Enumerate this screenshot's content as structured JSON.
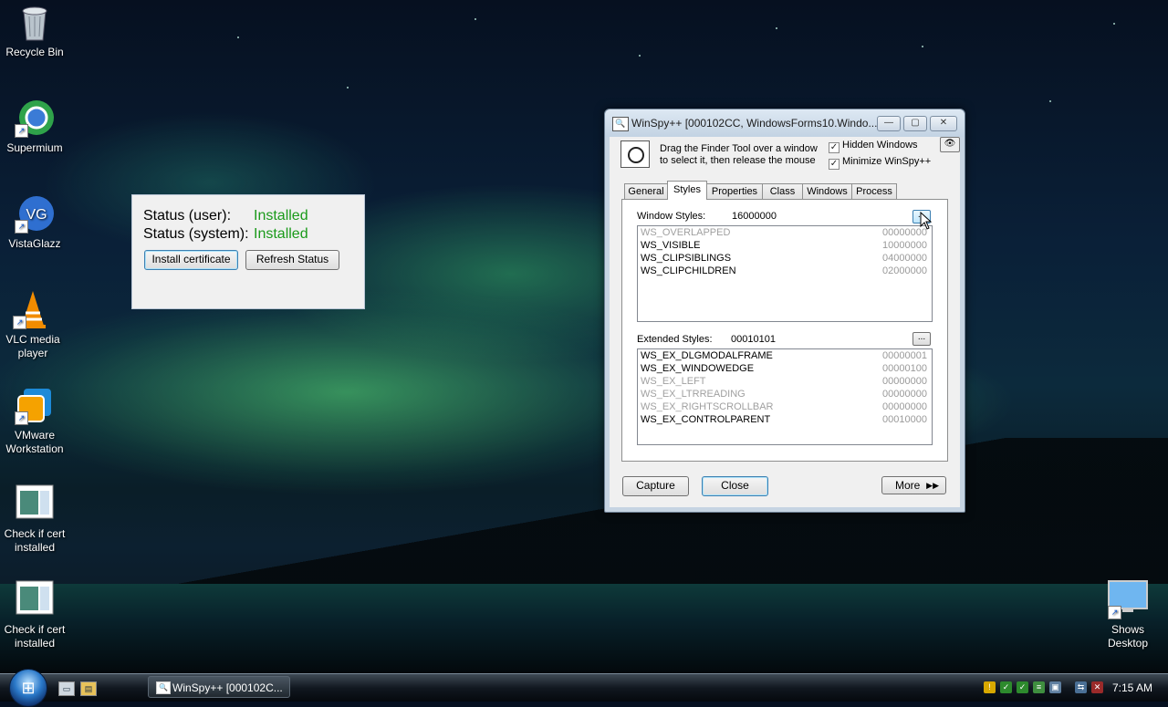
{
  "desktop": {
    "icons": [
      {
        "label": "Recycle Bin",
        "icon": "recycle-bin-icon"
      },
      {
        "label": "Supermium",
        "icon": "supermium-icon"
      },
      {
        "label": "VistaGlazz",
        "icon": "vistaglazz-icon"
      },
      {
        "label": "VLC media player",
        "icon": "vlc-icon"
      },
      {
        "label": "VMware Workstation",
        "icon": "vmware-icon"
      },
      {
        "label": "Check if cert installed",
        "icon": "cert-app-icon"
      },
      {
        "label": "Check if cert installed",
        "icon": "cert-app-icon"
      },
      {
        "label": "Shows Desktop",
        "icon": "show-desktop-icon"
      }
    ]
  },
  "status_panel": {
    "user_label": "Status (user):",
    "user_value": "Installed",
    "system_label": "Status (system):",
    "system_value": "Installed",
    "install_button": "Install certificate",
    "refresh_button": "Refresh Status",
    "status_color": "#1a9a1a"
  },
  "winspy": {
    "title": "WinSpy++ [000102CC, WindowsForms10.Windo...",
    "finder_text": "Drag the Finder Tool over a window to select it, then release the mouse",
    "hidden_windows_label": "Hidden Windows",
    "hidden_windows_checked": true,
    "minimize_label": "Minimize WinSpy++",
    "minimize_checked": true,
    "tabs": [
      "General",
      "Styles",
      "Properties",
      "Class",
      "Windows",
      "Process"
    ],
    "active_tab": "Styles",
    "window_styles_label": "Window Styles:",
    "window_styles_value": "16000000",
    "window_styles": [
      {
        "name": "WS_OVERLAPPED",
        "code": "00000000",
        "dim": true
      },
      {
        "name": "WS_VISIBLE",
        "code": "10000000",
        "dim": false
      },
      {
        "name": "WS_CLIPSIBLINGS",
        "code": "04000000",
        "dim": false
      },
      {
        "name": "WS_CLIPCHILDREN",
        "code": "02000000",
        "dim": false
      }
    ],
    "extended_styles_label": "Extended Styles:",
    "extended_styles_value": "00010101",
    "extended_styles": [
      {
        "name": "WS_EX_DLGMODALFRAME",
        "code": "00000001",
        "dim": false
      },
      {
        "name": "WS_EX_WINDOWEDGE",
        "code": "00000100",
        "dim": false
      },
      {
        "name": "WS_EX_LEFT",
        "code": "00000000",
        "dim": true
      },
      {
        "name": "WS_EX_LTRREADING",
        "code": "00000000",
        "dim": true
      },
      {
        "name": "WS_EX_RIGHTSCROLLBAR",
        "code": "00000000",
        "dim": true
      },
      {
        "name": "WS_EX_CONTROLPARENT",
        "code": "00010000",
        "dim": false
      }
    ],
    "ellipsis": "...",
    "capture_button": "Capture",
    "close_button": "Close",
    "more_button": "More"
  },
  "taskbar": {
    "task_label": "WinSpy++ [000102C...",
    "clock": "7:15 AM"
  }
}
